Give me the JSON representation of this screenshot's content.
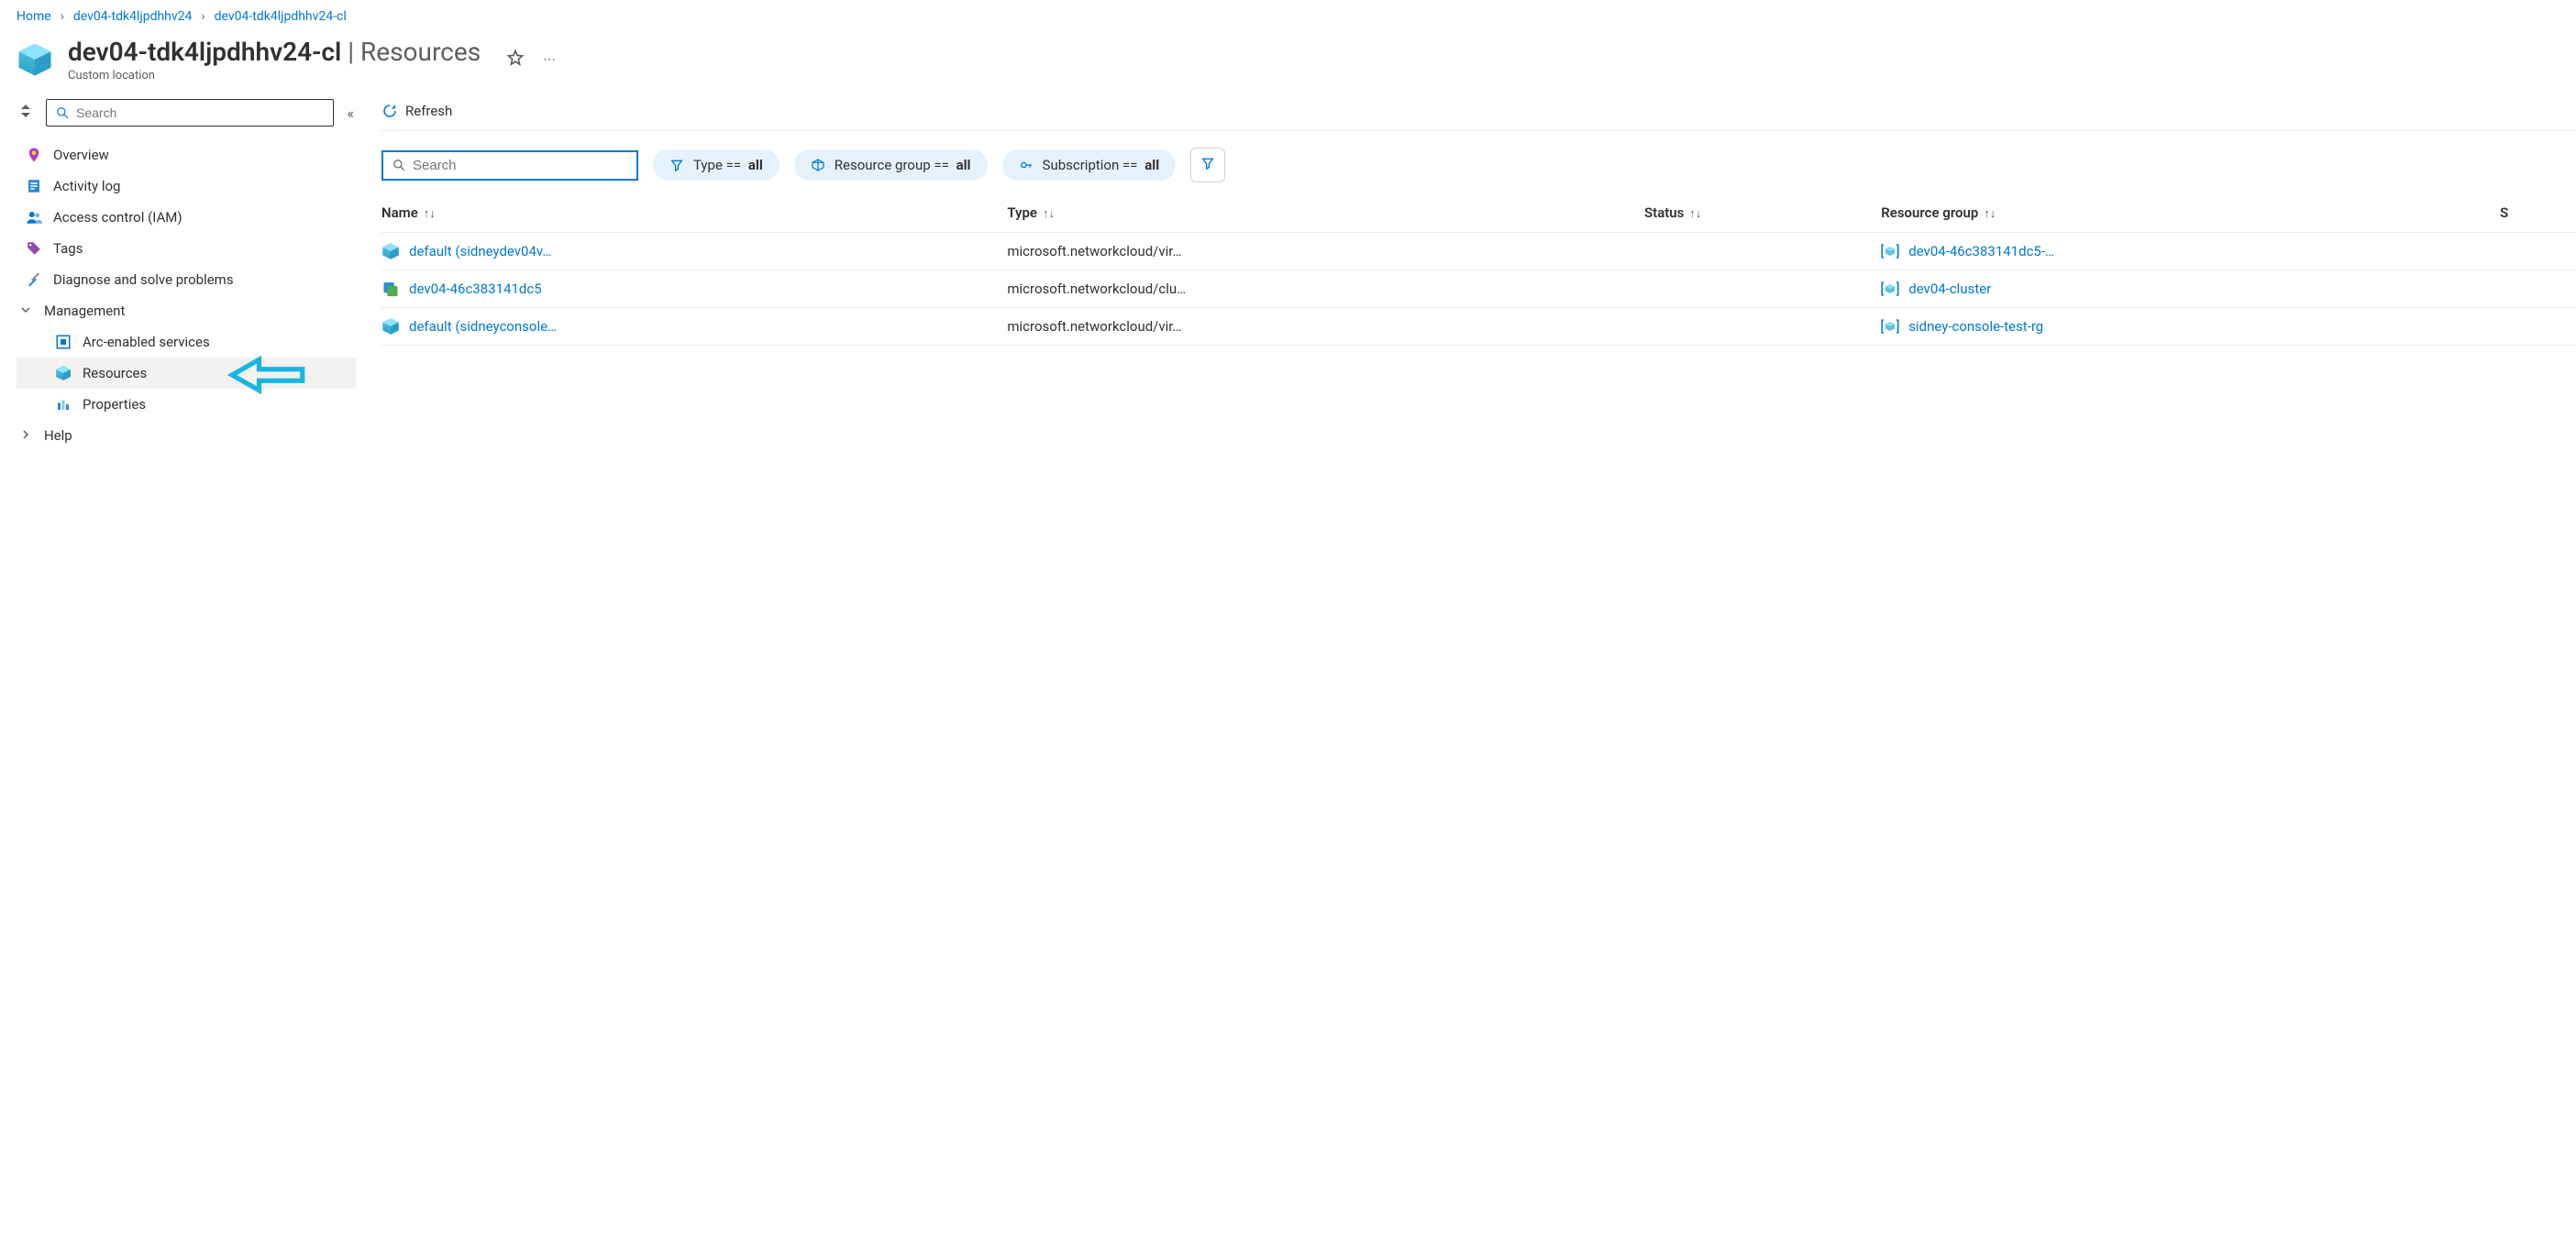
{
  "breadcrumb": {
    "home": "Home",
    "level1": "dev04-tdk4ljpdhhv24",
    "level2": "dev04-tdk4ljpdhhv24-cl"
  },
  "header": {
    "title": "dev04-tdk4ljpdhhv24-cl",
    "section": "Resources",
    "subtype": "Custom location"
  },
  "sidebar": {
    "search_placeholder": "Search",
    "overview": "Overview",
    "activity_log": "Activity log",
    "access_control": "Access control (IAM)",
    "tags": "Tags",
    "diagnose": "Diagnose and solve problems",
    "management": "Management",
    "arc_enabled": "Arc-enabled services",
    "resources": "Resources",
    "properties": "Properties",
    "help": "Help"
  },
  "toolbar": {
    "refresh": "Refresh"
  },
  "filters": {
    "search_placeholder": "Search",
    "type_label": "Type ==",
    "type_value": "all",
    "rg_label": "Resource group ==",
    "rg_value": "all",
    "sub_label": "Subscription ==",
    "sub_value": "all"
  },
  "table": {
    "columns": {
      "name": "Name",
      "type": "Type",
      "status": "Status",
      "resource_group": "Resource group",
      "subscription": "S"
    },
    "rows": [
      {
        "name": "default (sidneydev04v…",
        "type": "microsoft.networkcloud/vir…",
        "status": "",
        "rg": "dev04-46c383141dc5-…",
        "kind": "cube"
      },
      {
        "name": "dev04-46c383141dc5",
        "type": "microsoft.networkcloud/clu…",
        "status": "",
        "rg": "dev04-cluster",
        "kind": "cluster"
      },
      {
        "name": "default (sidneyconsole…",
        "type": "microsoft.networkcloud/vir…",
        "status": "",
        "rg": "sidney-console-test-rg",
        "kind": "cube",
        "highlight": true
      }
    ]
  }
}
